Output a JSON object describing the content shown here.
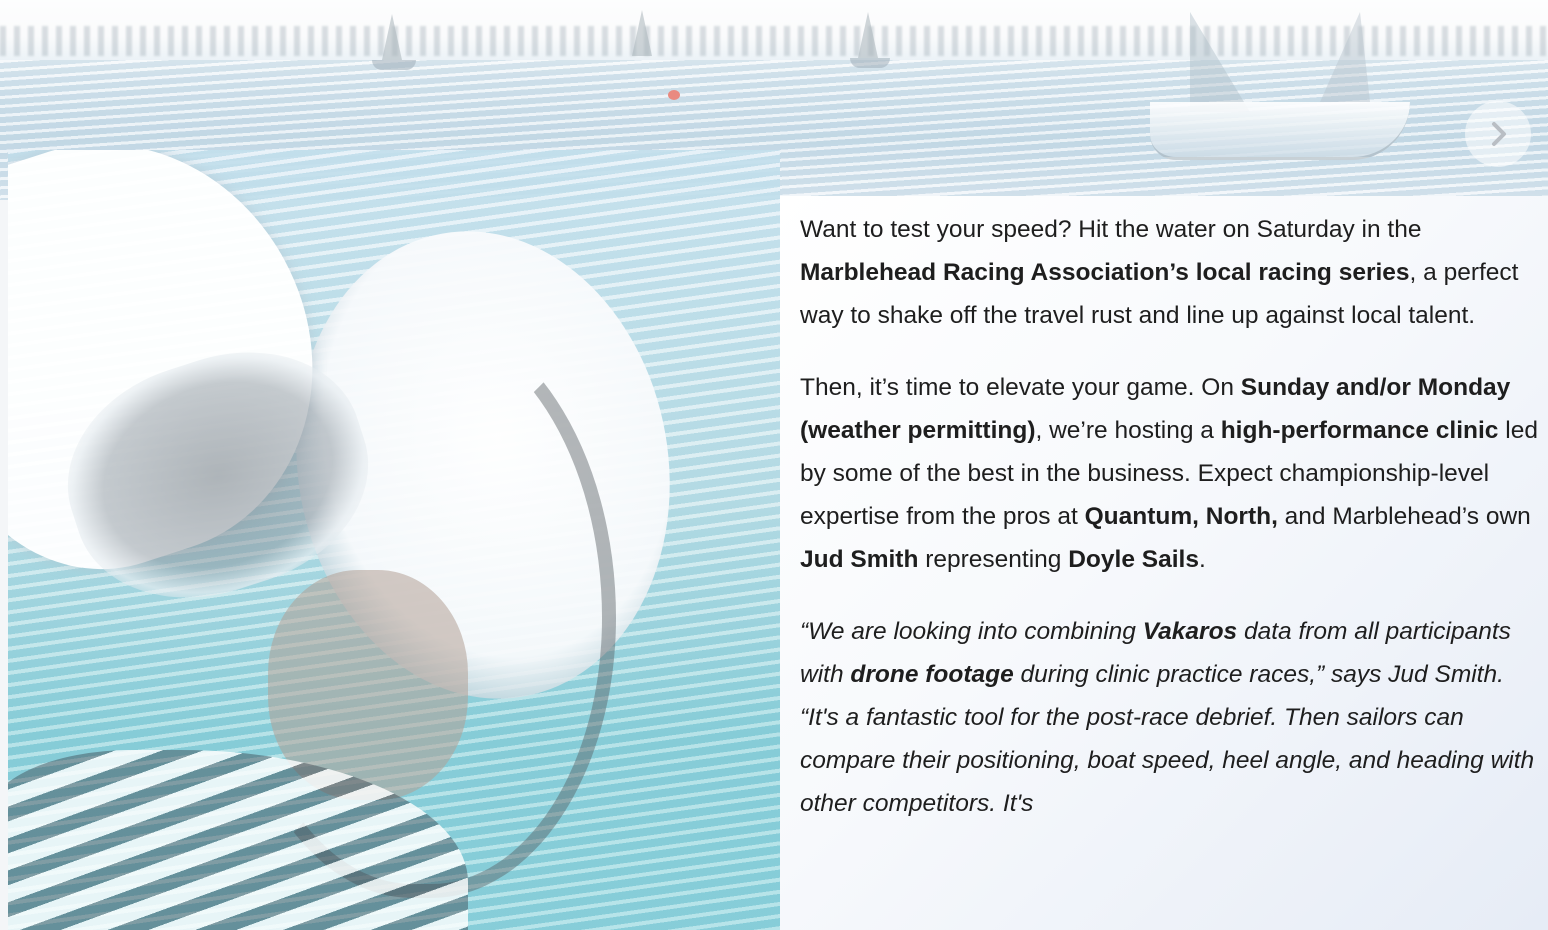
{
  "slider": {
    "next_icon": "chevron-right-icon"
  },
  "content": {
    "paragraph_1": {
      "t1": "Want to test your speed? Hit the water on Saturday in the ",
      "b1": "Marblehead Racing Association’s local racing series",
      "t2": ", a perfect way to shake off the travel rust and line up against local talent."
    },
    "paragraph_2": {
      "t1": "Then, it’s time to elevate your game. On ",
      "b1": "Sunday and/or Monday (weather permitting)",
      "t2": ", we’re hosting a ",
      "b2": "high-performance clinic",
      "t3": " led by some of the best in the business. Expect championship-level expertise from the pros at ",
      "b3": "Quantum, North,",
      "t4": " and Marblehead’s own ",
      "b4": "Jud Smith",
      "t5": " representing ",
      "b5": "Doyle Sails",
      "t6": "."
    },
    "paragraph_3": {
      "t1": "“We are looking into combining ",
      "b1": "Vakaros",
      "t2": " data from all participants with ",
      "b2": "drone footage",
      "t3": " during clinic practice races,” says Jud Smith. “It's a fantastic tool for the post-race debrief. Then sailors can compare their positioning, boat speed, heel angle, and heading with other competitors. It's"
    }
  }
}
